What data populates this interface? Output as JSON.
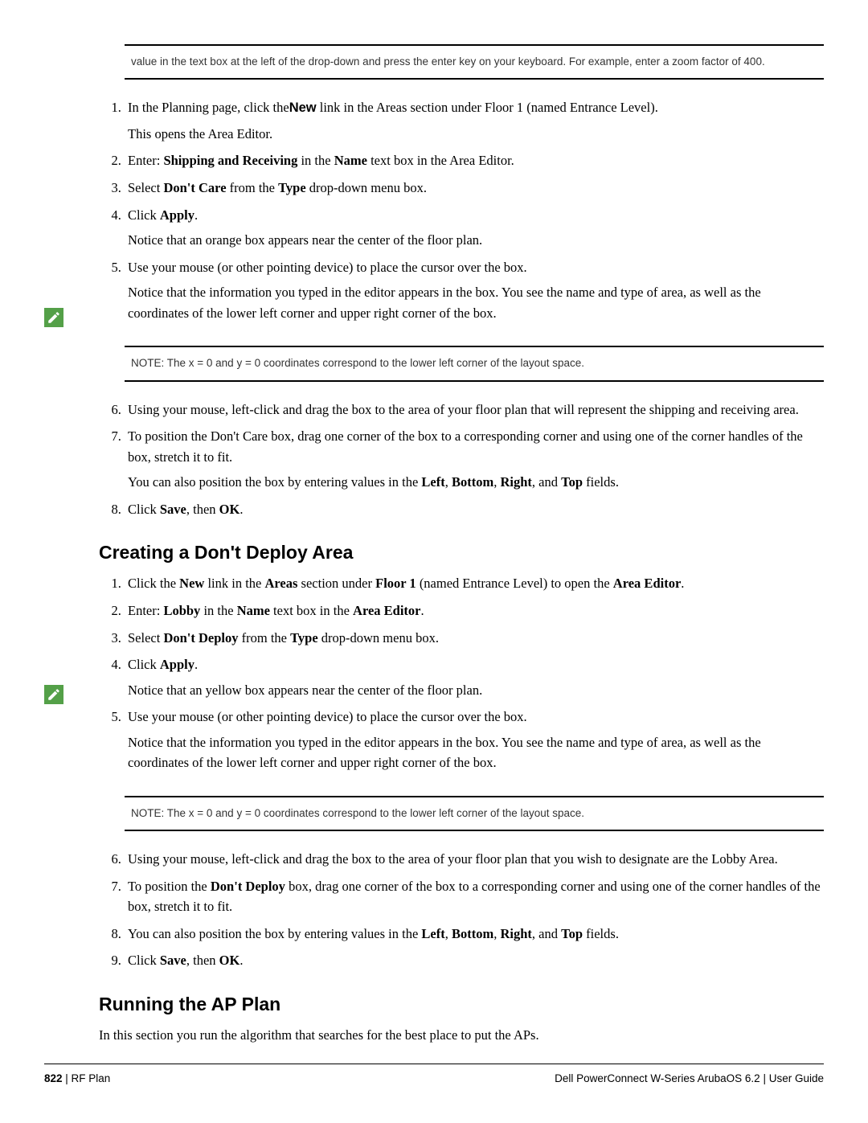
{
  "noteA": "value in the text box at the left of the drop-down and press the enter key on your keyboard. For example, enter a zoom factor of 400.",
  "stepsA": {
    "s1_a": "In the Planning page, click the",
    "s1_new": "New",
    "s1_b": " link in the Areas section under Floor 1 (named Entrance Level).",
    "s1_p": "This opens the Area Editor.",
    "s2_a": "Enter: ",
    "s2_b": "Shipping and Receiving",
    "s2_c": " in the ",
    "s2_d": "Name",
    "s2_e": " text box in the Area Editor.",
    "s3_a": "Select ",
    "s3_b": "Don't Care",
    "s3_c": " from the ",
    "s3_d": "Type",
    "s3_e": " drop-down menu box.",
    "s4_a": "Click ",
    "s4_b": "Apply",
    "s4_c": ".",
    "s4_p": "Notice that an orange box appears near the center of the floor plan.",
    "s5": "Use your mouse (or other pointing device) to place the cursor over the box.",
    "s5_p": "Notice that the information you typed in the editor appears in the box. You see the name and type of area, as well as the coordinates of the lower left corner and upper right corner of the box."
  },
  "noteB": "NOTE: The x = 0 and y = 0 coordinates correspond to the lower left corner of the layout space.",
  "stepsA2": {
    "s6": "Using your mouse, left-click and drag the box to the area of your floor plan that will represent the shipping and receiving area.",
    "s7": "To position the Don't Care box, drag one corner of the box to a corresponding corner and using one of the corner handles of the box, stretch it to fit.",
    "s7_p_a": "You can also position the box by entering values in the ",
    "s7_p_b": "Left",
    "s7_p_c": ", ",
    "s7_p_d": "Bottom",
    "s7_p_e": ", ",
    "s7_p_f": "Right",
    "s7_p_g": ", and ",
    "s7_p_h": "Top",
    "s7_p_i": " fields.",
    "s8_a": "Click ",
    "s8_b": "Save",
    "s8_c": ", then ",
    "s8_d": "OK",
    "s8_e": "."
  },
  "hB": "Creating a Don't Deploy Area",
  "stepsB": {
    "s1_a": "Click the ",
    "s1_b": "New",
    "s1_c": " link in the ",
    "s1_d": "Areas",
    "s1_e": " section under ",
    "s1_f": "Floor 1",
    "s1_g": " (named Entrance Level) to open the ",
    "s1_h": "Area Editor",
    "s1_i": ".",
    "s2_a": "Enter: ",
    "s2_b": "Lobby",
    "s2_c": " in the ",
    "s2_d": "Name",
    "s2_e": " text box in the ",
    "s2_f": "Area Editor",
    "s2_g": ".",
    "s3_a": "Select ",
    "s3_b": "Don't Deploy",
    "s3_c": " from the ",
    "s3_d": "Type",
    "s3_e": " drop-down menu box.",
    "s4_a": "Click ",
    "s4_b": "Apply",
    "s4_c": ".",
    "s4_p": "Notice that an yellow box appears near the center of the floor plan.",
    "s5": "Use your mouse (or other pointing device) to place the cursor over the box.",
    "s5_p": "Notice that the information you typed in the editor appears in the box. You see the name and type of area, as well as the coordinates of the lower left corner and upper right corner of the box."
  },
  "noteC": "NOTE: The x = 0 and y = 0 coordinates correspond to the lower left corner of the layout space.",
  "stepsB2": {
    "s6": "Using your mouse, left-click and drag the box to the area of your floor plan that you wish to designate are the Lobby Area.",
    "s7_a": "To position the ",
    "s7_b": "Don't Deploy",
    "s7_c": " box, drag one corner of the box to a corresponding corner and using one of the corner handles of the box, stretch it to fit.",
    "s8_a": "You can also position the box by entering values in the ",
    "s8_b": "Left",
    "s8_c": ", ",
    "s8_d": "Bottom",
    "s8_e": ", ",
    "s8_f": "Right",
    "s8_g": ", and ",
    "s8_h": "Top",
    "s8_i": " fields.",
    "s9_a": "Click ",
    "s9_b": "Save",
    "s9_c": ", then ",
    "s9_d": "OK",
    "s9_e": "."
  },
  "hC": "Running the AP Plan",
  "pC": "In this section you run the algorithm that searches for the best place to put the APs.",
  "footer": {
    "page": "822",
    "sep": " | ",
    "section": "RF Plan",
    "right_a": "Dell PowerConnect W-Series ArubaOS 6.2 ",
    "right_b": " | ",
    "right_c": " User Guide"
  }
}
